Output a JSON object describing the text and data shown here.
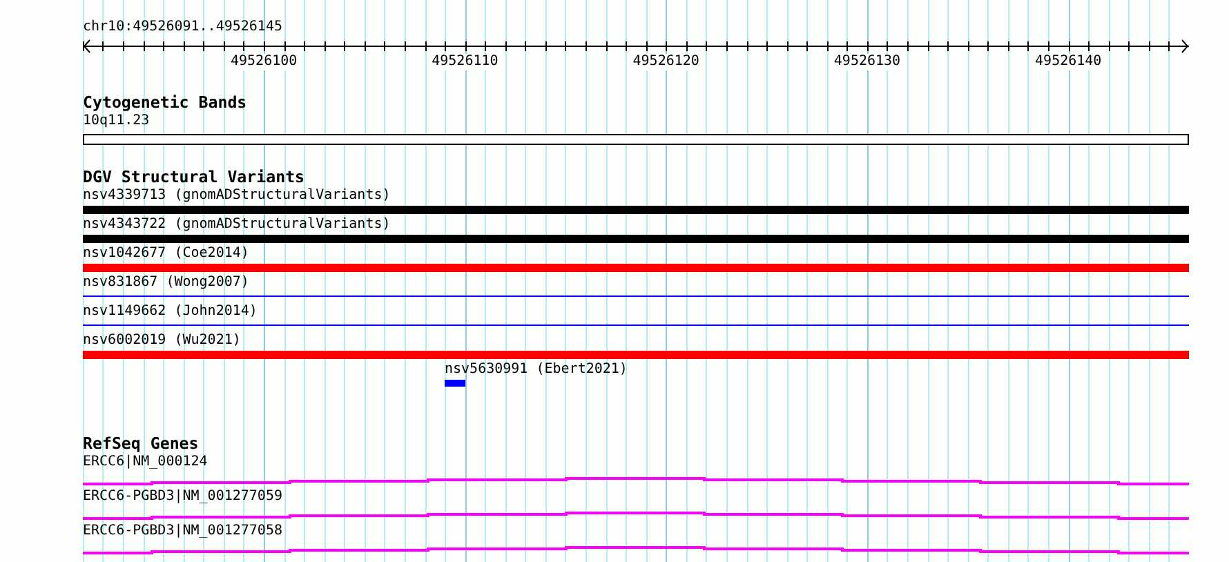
{
  "ruler": {
    "location": "chr10:49526091..49526145",
    "tick_labels": [
      "49526100",
      "49526110",
      "49526120",
      "49526130",
      "49526140"
    ]
  },
  "tracks": [
    {
      "title": "Cytogenetic Bands",
      "features": [
        {
          "kind": "band",
          "label": "10q11.23",
          "color": "#000000"
        }
      ]
    },
    {
      "title": "DGV Structural Variants",
      "features": [
        {
          "kind": "thick",
          "label": "nsv4339713 (gnomADStructuralVariants)",
          "color": "#000000"
        },
        {
          "kind": "thick",
          "label": "nsv4343722 (gnomADStructuralVariants)",
          "color": "#000000"
        },
        {
          "kind": "thick",
          "label": "nsv1042677 (Coe2014)",
          "color": "#ff0000"
        },
        {
          "kind": "thin",
          "label": "nsv831867 (Wong2007)",
          "color": "#0000ff"
        },
        {
          "kind": "thin",
          "label": "nsv1149662 (John2014)",
          "color": "#0000ff"
        },
        {
          "kind": "thick",
          "label": "nsv6002019 (Wu2021)",
          "color": "#ff0000"
        },
        {
          "kind": "short",
          "label": "nsv5630991 (Ebert2021)",
          "color": "#0000ff"
        }
      ]
    },
    {
      "title": "RefSeq Genes",
      "features": [
        {
          "kind": "gene",
          "label": "ERCC6|NM_000124",
          "color": "#ff00ff"
        },
        {
          "kind": "gene",
          "label": "ERCC6-PGBD3|NM_001277059",
          "color": "#ff00ff"
        },
        {
          "kind": "gene",
          "label": "ERCC6-PGBD3|NM_001277058",
          "color": "#ff00ff"
        }
      ]
    }
  ]
}
